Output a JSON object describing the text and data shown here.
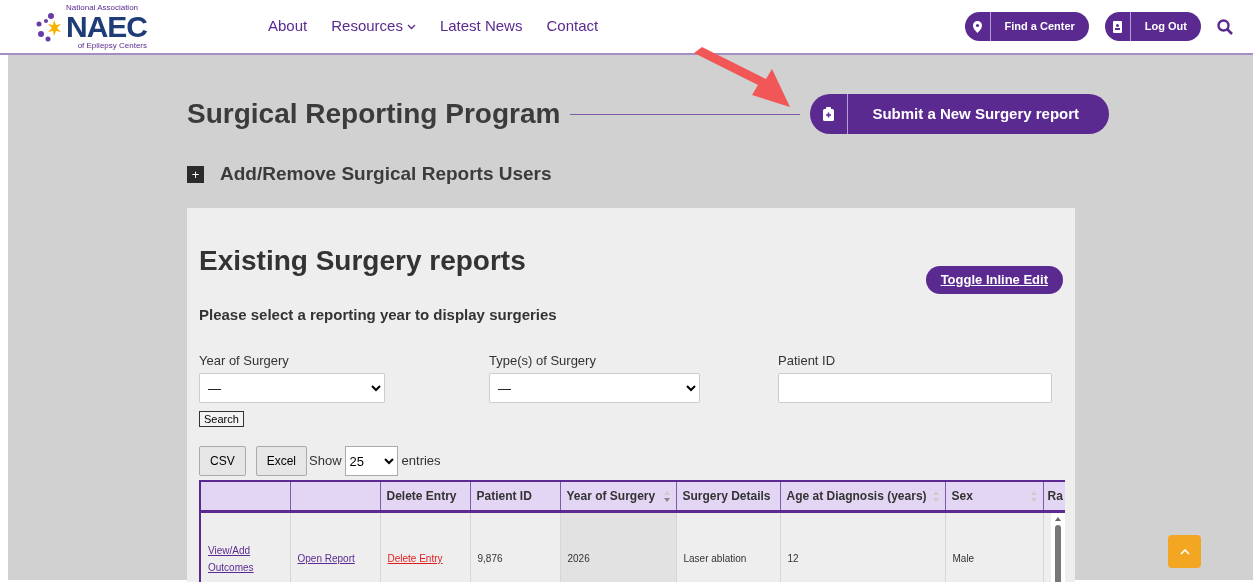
{
  "header": {
    "logo": {
      "name": "NAEC",
      "line1": "National Association",
      "line2": "of Epilepsy Centers"
    },
    "nav": [
      {
        "label": "About",
        "dropdown": false
      },
      {
        "label": "Resources",
        "dropdown": true
      },
      {
        "label": "Latest News",
        "dropdown": false
      },
      {
        "label": "Contact",
        "dropdown": false
      }
    ],
    "actions": [
      {
        "label": "Find a Center"
      },
      {
        "label": "Log Out"
      }
    ]
  },
  "page": {
    "title": "Surgical Reporting Program",
    "submit_button": "Submit a New Surgery report",
    "expander": {
      "symbol": "+",
      "label": "Add/Remove Surgical Reports Users"
    },
    "panel": {
      "heading": "Existing Surgery reports",
      "toggle_button": "Toggle Inline Edit",
      "prompt": "Please select a reporting year to display surgeries",
      "filters": [
        {
          "label": "Year of Surgery",
          "kind": "select",
          "value": "—"
        },
        {
          "label": "Type(s) of Surgery",
          "kind": "select",
          "value": "—"
        },
        {
          "label": "Patient ID",
          "kind": "text"
        }
      ],
      "search_button": "Search",
      "export_buttons": [
        "CSV",
        "Excel"
      ],
      "show_label": "Show",
      "page_length": "25",
      "entries_label": "entries",
      "table": {
        "columns": [
          {
            "sortable": false,
            "sorted": false
          },
          {
            "sortable": false,
            "sorted": false
          },
          {
            "label": "Delete Entry",
            "sortable": false,
            "sorted": false
          },
          {
            "label": "Patient ID",
            "sortable": false,
            "sorted": false
          },
          {
            "label": "Year of Surgery",
            "sortable": true,
            "sorted": true
          },
          {
            "label": "Surgery Details",
            "sortable": false,
            "sorted": false
          },
          {
            "label": "Age at Diagnosis (years)",
            "sortable": true,
            "sorted": false
          },
          {
            "label": "Sex",
            "sortable": true,
            "sorted": false
          },
          {
            "label": "Ra",
            "sortable": false,
            "sorted": false
          }
        ],
        "rows": [
          {
            "cells": [
              {
                "text": "View/Add Outcomes",
                "kind": "link"
              },
              {
                "text": "Open Report",
                "kind": "link"
              },
              {
                "text": "Delete Entry",
                "kind": "danger"
              },
              {
                "text": "9,876"
              },
              {
                "text": "2026"
              },
              {
                "text": "Laser ablation"
              },
              {
                "text": "12"
              },
              {
                "text": "Male"
              }
            ]
          }
        ]
      }
    }
  }
}
